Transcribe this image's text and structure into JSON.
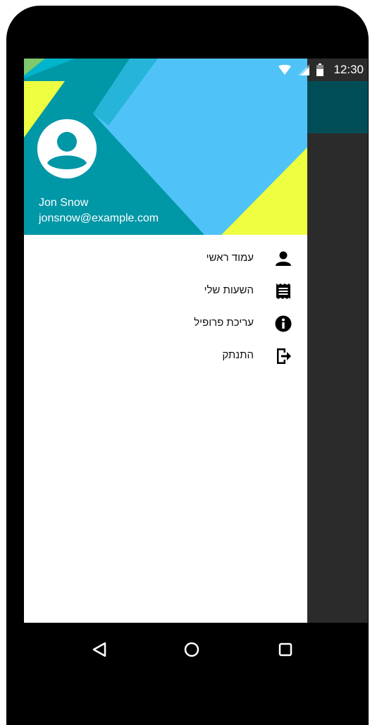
{
  "status_bar": {
    "time": "12:30",
    "icons": [
      "wifi-icon",
      "signal-icon",
      "battery-icon"
    ]
  },
  "drawer": {
    "header": {
      "name": "Jon Snow",
      "email": "jonsnow@example.com",
      "colors": {
        "teal": "#0097a7",
        "light_blue": "#4fc3f7",
        "cyan": "#00bcd4",
        "yellow": "#eeff41"
      }
    },
    "items": [
      {
        "label": "עמוד ראשי",
        "icon": "person-icon"
      },
      {
        "label": "השעות שלי",
        "icon": "receipt-icon"
      },
      {
        "label": "עריכת פרופיל",
        "icon": "info-icon"
      },
      {
        "label": "התנתק",
        "icon": "logout-icon"
      }
    ]
  },
  "nav_bar": {
    "buttons": [
      "back-icon",
      "home-icon",
      "recents-icon"
    ]
  },
  "colors": {
    "appbar": "#004d57",
    "scrim": "#2b2b2b",
    "device": "#000000"
  }
}
